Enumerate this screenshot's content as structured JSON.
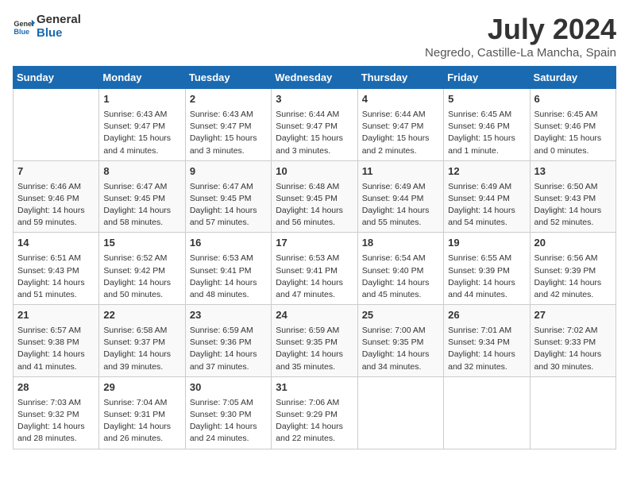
{
  "header": {
    "logo_line1": "General",
    "logo_line2": "Blue",
    "month": "July 2024",
    "location": "Negredo, Castille-La Mancha, Spain"
  },
  "days_of_week": [
    "Sunday",
    "Monday",
    "Tuesday",
    "Wednesday",
    "Thursday",
    "Friday",
    "Saturday"
  ],
  "weeks": [
    [
      {
        "day": "",
        "info": ""
      },
      {
        "day": "1",
        "info": "Sunrise: 6:43 AM\nSunset: 9:47 PM\nDaylight: 15 hours\nand 4 minutes."
      },
      {
        "day": "2",
        "info": "Sunrise: 6:43 AM\nSunset: 9:47 PM\nDaylight: 15 hours\nand 3 minutes."
      },
      {
        "day": "3",
        "info": "Sunrise: 6:44 AM\nSunset: 9:47 PM\nDaylight: 15 hours\nand 3 minutes."
      },
      {
        "day": "4",
        "info": "Sunrise: 6:44 AM\nSunset: 9:47 PM\nDaylight: 15 hours\nand 2 minutes."
      },
      {
        "day": "5",
        "info": "Sunrise: 6:45 AM\nSunset: 9:46 PM\nDaylight: 15 hours\nand 1 minute."
      },
      {
        "day": "6",
        "info": "Sunrise: 6:45 AM\nSunset: 9:46 PM\nDaylight: 15 hours\nand 0 minutes."
      }
    ],
    [
      {
        "day": "7",
        "info": "Sunrise: 6:46 AM\nSunset: 9:46 PM\nDaylight: 14 hours\nand 59 minutes."
      },
      {
        "day": "8",
        "info": "Sunrise: 6:47 AM\nSunset: 9:45 PM\nDaylight: 14 hours\nand 58 minutes."
      },
      {
        "day": "9",
        "info": "Sunrise: 6:47 AM\nSunset: 9:45 PM\nDaylight: 14 hours\nand 57 minutes."
      },
      {
        "day": "10",
        "info": "Sunrise: 6:48 AM\nSunset: 9:45 PM\nDaylight: 14 hours\nand 56 minutes."
      },
      {
        "day": "11",
        "info": "Sunrise: 6:49 AM\nSunset: 9:44 PM\nDaylight: 14 hours\nand 55 minutes."
      },
      {
        "day": "12",
        "info": "Sunrise: 6:49 AM\nSunset: 9:44 PM\nDaylight: 14 hours\nand 54 minutes."
      },
      {
        "day": "13",
        "info": "Sunrise: 6:50 AM\nSunset: 9:43 PM\nDaylight: 14 hours\nand 52 minutes."
      }
    ],
    [
      {
        "day": "14",
        "info": "Sunrise: 6:51 AM\nSunset: 9:43 PM\nDaylight: 14 hours\nand 51 minutes."
      },
      {
        "day": "15",
        "info": "Sunrise: 6:52 AM\nSunset: 9:42 PM\nDaylight: 14 hours\nand 50 minutes."
      },
      {
        "day": "16",
        "info": "Sunrise: 6:53 AM\nSunset: 9:41 PM\nDaylight: 14 hours\nand 48 minutes."
      },
      {
        "day": "17",
        "info": "Sunrise: 6:53 AM\nSunset: 9:41 PM\nDaylight: 14 hours\nand 47 minutes."
      },
      {
        "day": "18",
        "info": "Sunrise: 6:54 AM\nSunset: 9:40 PM\nDaylight: 14 hours\nand 45 minutes."
      },
      {
        "day": "19",
        "info": "Sunrise: 6:55 AM\nSunset: 9:39 PM\nDaylight: 14 hours\nand 44 minutes."
      },
      {
        "day": "20",
        "info": "Sunrise: 6:56 AM\nSunset: 9:39 PM\nDaylight: 14 hours\nand 42 minutes."
      }
    ],
    [
      {
        "day": "21",
        "info": "Sunrise: 6:57 AM\nSunset: 9:38 PM\nDaylight: 14 hours\nand 41 minutes."
      },
      {
        "day": "22",
        "info": "Sunrise: 6:58 AM\nSunset: 9:37 PM\nDaylight: 14 hours\nand 39 minutes."
      },
      {
        "day": "23",
        "info": "Sunrise: 6:59 AM\nSunset: 9:36 PM\nDaylight: 14 hours\nand 37 minutes."
      },
      {
        "day": "24",
        "info": "Sunrise: 6:59 AM\nSunset: 9:35 PM\nDaylight: 14 hours\nand 35 minutes."
      },
      {
        "day": "25",
        "info": "Sunrise: 7:00 AM\nSunset: 9:35 PM\nDaylight: 14 hours\nand 34 minutes."
      },
      {
        "day": "26",
        "info": "Sunrise: 7:01 AM\nSunset: 9:34 PM\nDaylight: 14 hours\nand 32 minutes."
      },
      {
        "day": "27",
        "info": "Sunrise: 7:02 AM\nSunset: 9:33 PM\nDaylight: 14 hours\nand 30 minutes."
      }
    ],
    [
      {
        "day": "28",
        "info": "Sunrise: 7:03 AM\nSunset: 9:32 PM\nDaylight: 14 hours\nand 28 minutes."
      },
      {
        "day": "29",
        "info": "Sunrise: 7:04 AM\nSunset: 9:31 PM\nDaylight: 14 hours\nand 26 minutes."
      },
      {
        "day": "30",
        "info": "Sunrise: 7:05 AM\nSunset: 9:30 PM\nDaylight: 14 hours\nand 24 minutes."
      },
      {
        "day": "31",
        "info": "Sunrise: 7:06 AM\nSunset: 9:29 PM\nDaylight: 14 hours\nand 22 minutes."
      },
      {
        "day": "",
        "info": ""
      },
      {
        "day": "",
        "info": ""
      },
      {
        "day": "",
        "info": ""
      }
    ]
  ]
}
